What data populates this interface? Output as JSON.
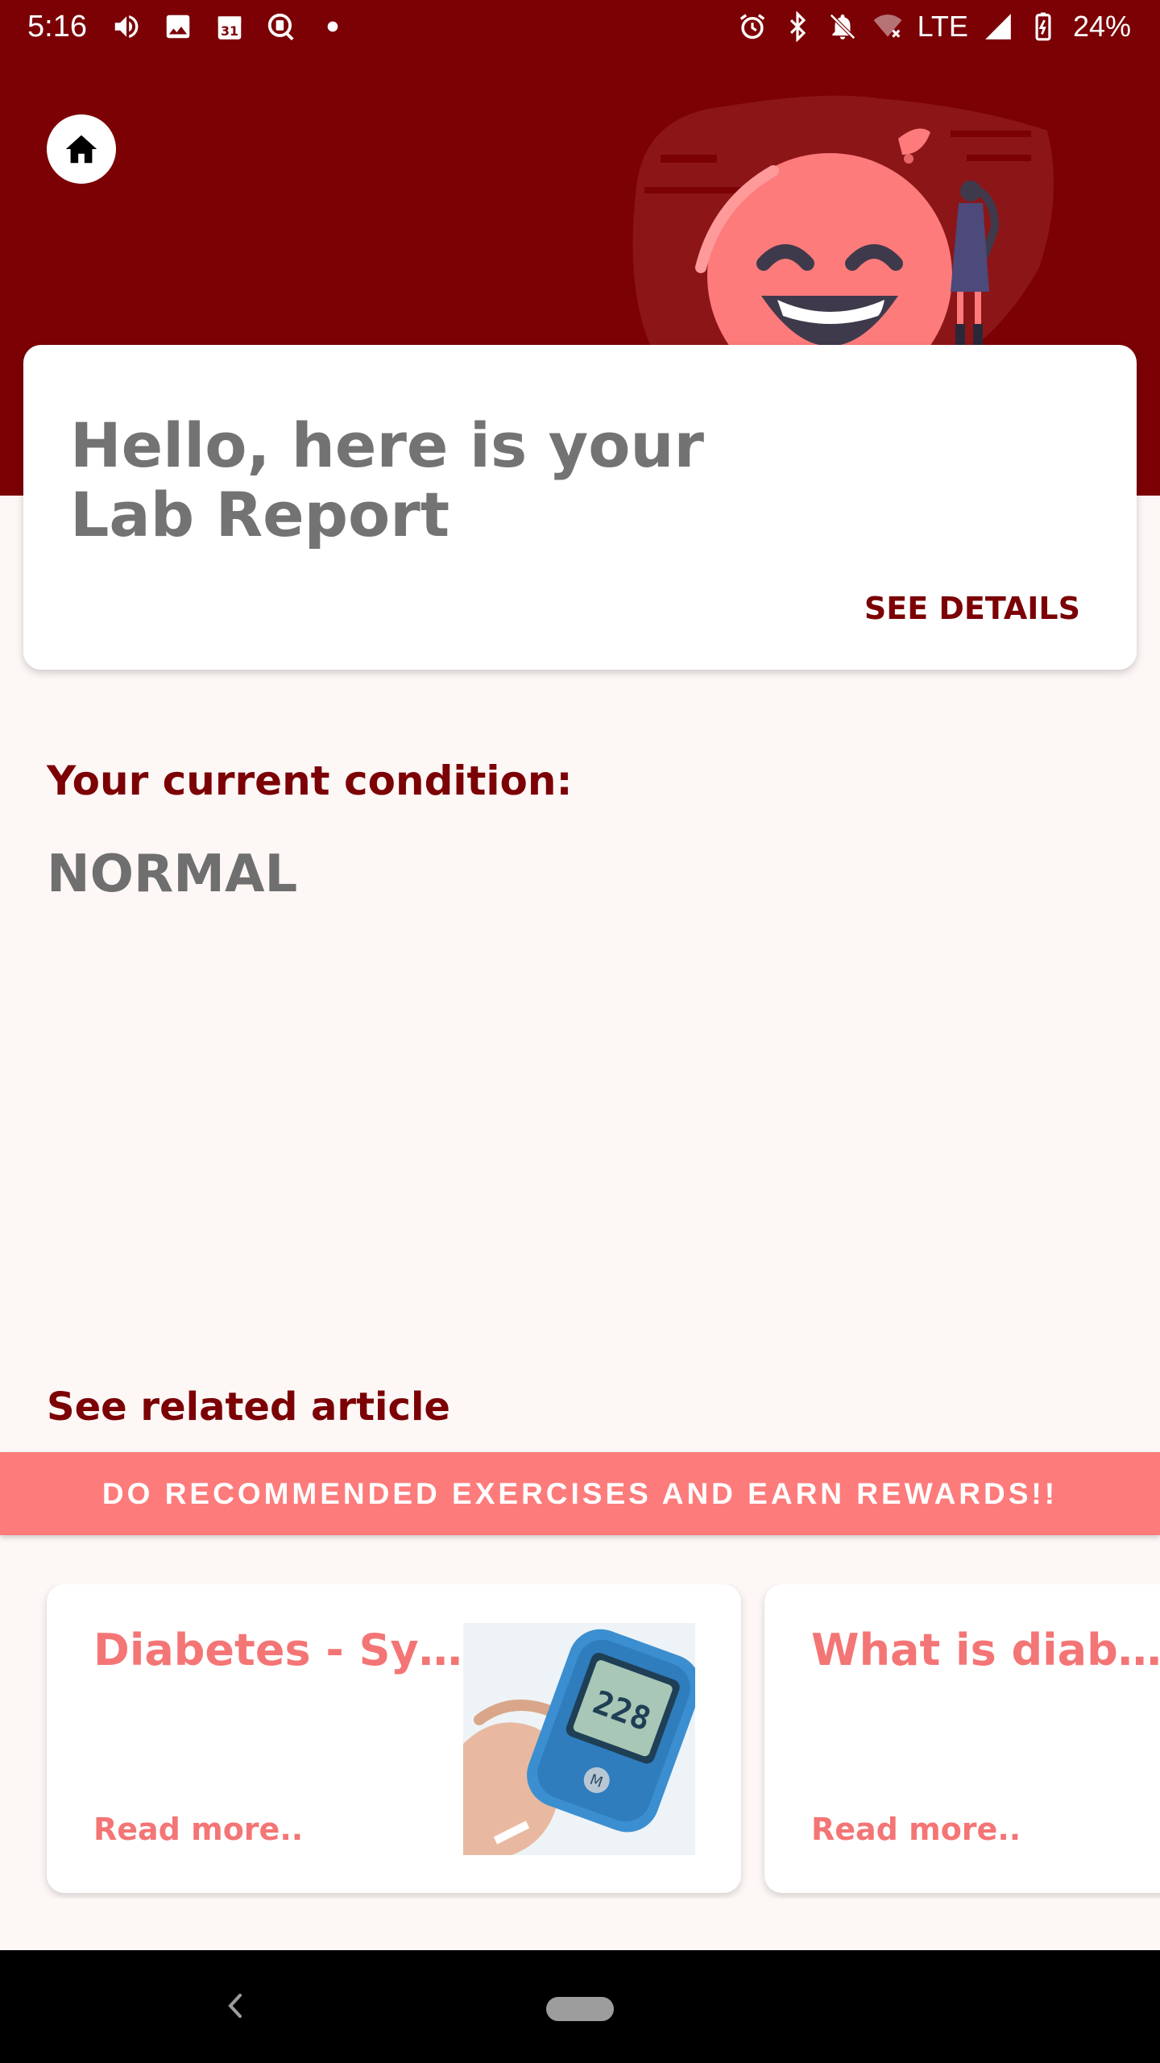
{
  "status_bar": {
    "time": "5:16",
    "network": "LTE",
    "battery": "24%",
    "left_icons": [
      "volume-icon",
      "image-icon",
      "calendar-icon",
      "assistant-icon",
      "dot-icon"
    ],
    "right_icons": [
      "alarm-icon",
      "bluetooth-icon",
      "bell-off-icon",
      "wifi-off-icon",
      "signal-icon",
      "battery-charging-icon"
    ],
    "calendar_day": "31"
  },
  "header": {
    "home_icon": "home-icon",
    "illustration": "smiling-face-illustration"
  },
  "greeting_card": {
    "title_line1": "Hello, here is your",
    "title_line2": "Lab Report",
    "action": "SEE DETAILS"
  },
  "condition": {
    "label": "Your current condition:",
    "value": "NORMAL"
  },
  "related": {
    "label": "See related article"
  },
  "banner": {
    "text": "DO RECOMMENDED EXERCISES AND EARN REWARDS!!"
  },
  "articles": [
    {
      "title": "Diabetes - Symp…",
      "action": "Read more..",
      "thumbnail": "glucose-meter-image"
    },
    {
      "title": "What is diabete…",
      "action": "Read more..",
      "thumbnail": ""
    }
  ],
  "colors": {
    "primary": "#7b0105",
    "accent": "#fd7b7b",
    "accent_text": "#f47575",
    "background": "#fdf7f6",
    "muted_text": "#737373"
  },
  "nav": {
    "back_icon": "back-chevron-icon",
    "home_pill": "home-pill"
  }
}
